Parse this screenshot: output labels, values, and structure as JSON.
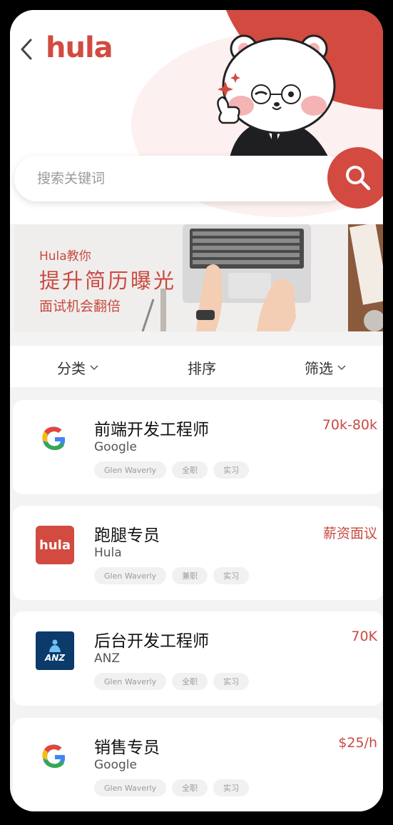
{
  "header": {
    "logo_text": "hula"
  },
  "search": {
    "placeholder": "搜索关键词"
  },
  "banner": {
    "line1": "Hula教你",
    "line2": "提升简历曝光",
    "line3": "面试机会翻倍"
  },
  "filters": {
    "category": "分类",
    "sort": "排序",
    "filter": "筛选"
  },
  "jobs": [
    {
      "title": "前端开发工程师",
      "company": "Google",
      "salary": "70k-80k",
      "tags": [
        "Glen Waverly",
        "全职",
        "实习"
      ],
      "logo": "google-logo"
    },
    {
      "title": "跑腿专员",
      "company": "Hula",
      "salary": "薪资面议",
      "tags": [
        "Glen Waverly",
        "兼职",
        "实习"
      ],
      "logo": "hula-logo",
      "logo_text": "hula"
    },
    {
      "title": "后台开发工程师",
      "company": "ANZ",
      "salary": "70K",
      "tags": [
        "Glen Waverly",
        "全职",
        "实习"
      ],
      "logo": "anz-logo",
      "logo_text": "ANZ"
    },
    {
      "title": "销售专员",
      "company": "Google",
      "salary": "$25/h",
      "tags": [
        "Glen Waverly",
        "全职",
        "实习"
      ],
      "logo": "google-logo"
    }
  ],
  "colors": {
    "brand": "#d24a40",
    "salary": "#c94a42"
  }
}
